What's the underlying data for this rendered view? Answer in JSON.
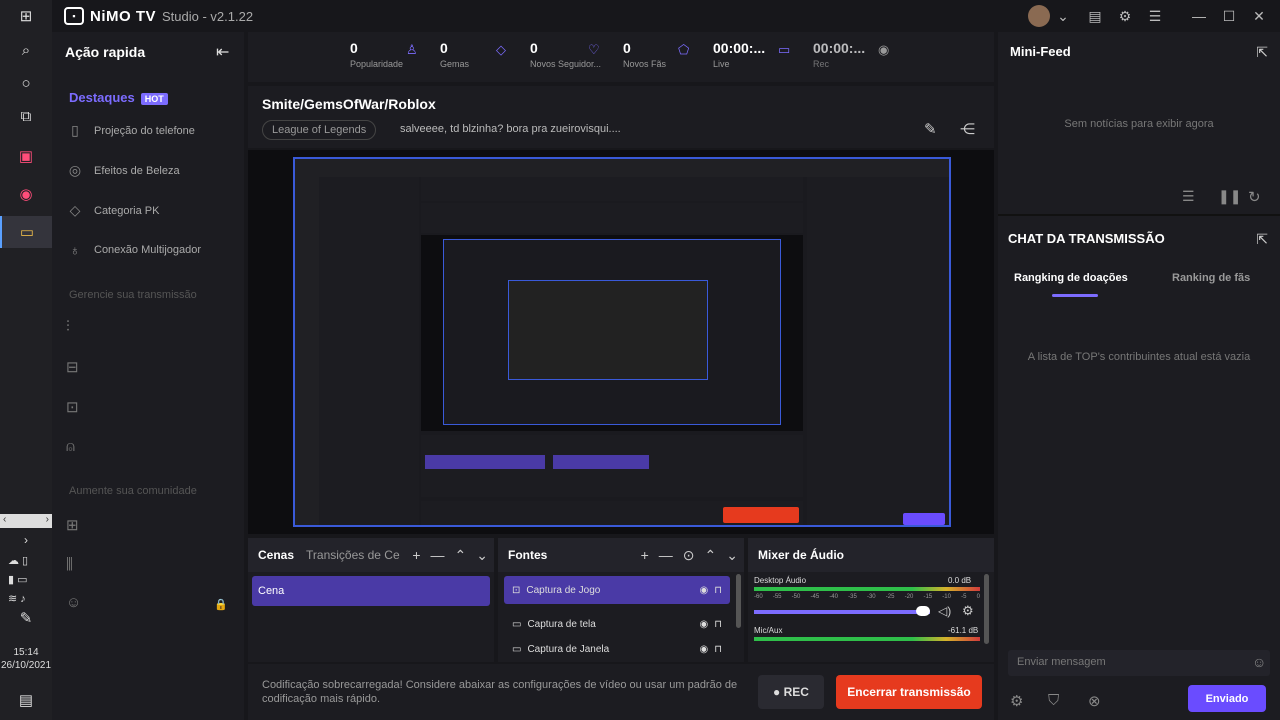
{
  "app": {
    "brand": "NiMO TV",
    "suffix": "Studio - v2.1.22"
  },
  "taskbar": {
    "time": "15:14",
    "date": "26/10/2021"
  },
  "left_panel": {
    "title": "Ação rapida",
    "highlights_title": "Destaques",
    "hot_badge": "HOT",
    "items": [
      "Projeção do telefone",
      "Efeitos de Beleza",
      "Categoria PK",
      "Conexão Multijogador"
    ],
    "manage_title": "Gerencie sua transmissão",
    "community_title": "Aumente sua comunidade"
  },
  "stats": [
    {
      "value": "0",
      "label": "Popularidade",
      "icon": "person-icon"
    },
    {
      "value": "0",
      "label": "Gemas",
      "icon": "gem-icon"
    },
    {
      "value": "0",
      "label": "Novos Seguidor...",
      "icon": "heart-icon"
    },
    {
      "value": "0",
      "label": "Novos Fãs",
      "icon": "badge-icon"
    },
    {
      "value": "00:00:...",
      "label": "Live",
      "icon": "camera-icon"
    },
    {
      "value": "00:00:...",
      "label": "Rec",
      "icon": "record-icon"
    }
  ],
  "stream": {
    "title": "Smite/GemsOfWar/Roblox",
    "category": "League of Legends",
    "notice": "salveeee, td blzinha? bora pra zueirovisqui...."
  },
  "scenes": {
    "tab_active": "Cenas",
    "tab_other": "Transições de Cena",
    "items": [
      "Cena"
    ]
  },
  "sources": {
    "title": "Fontes",
    "items": [
      "Captura de Jogo",
      "Captura de tela",
      "Captura de Janela"
    ]
  },
  "mixer": {
    "title": "Mixer de Áudio",
    "channels": [
      {
        "name": "Desktop Áudio",
        "db": "0.0 dB",
        "level": 0.97
      },
      {
        "name": "Mic/Aux",
        "db": "-61.1 dB",
        "level": 0.9
      }
    ],
    "scale": [
      "-60",
      "-55",
      "-50",
      "-45",
      "-40",
      "-35",
      "-30",
      "-25",
      "-20",
      "-15",
      "-10",
      "-5",
      "0"
    ]
  },
  "footer": {
    "warning": "Codificação sobrecarregada! Considere abaixar as configurações de vídeo ou usar um padrão de codificação mais rápido.",
    "rec": "● REC",
    "end": "Encerrar transmissão"
  },
  "right_panel": {
    "minifeed_title": "Mini-Feed",
    "minifeed_empty": "Sem notícias para exibir agora",
    "chat_title": "CHAT DA TRANSMISSÃO",
    "tab_active": "Rangking de doações",
    "tab_other": "Ranking de fãs",
    "list_empty": "A lista de TOP's contribuintes atual está vazia",
    "input_placeholder": "Enviar mensagem",
    "send": "Enviado"
  },
  "colors": {
    "accent": "#7c6cff",
    "danger": "#e63a1e",
    "bg": "#17171b"
  }
}
